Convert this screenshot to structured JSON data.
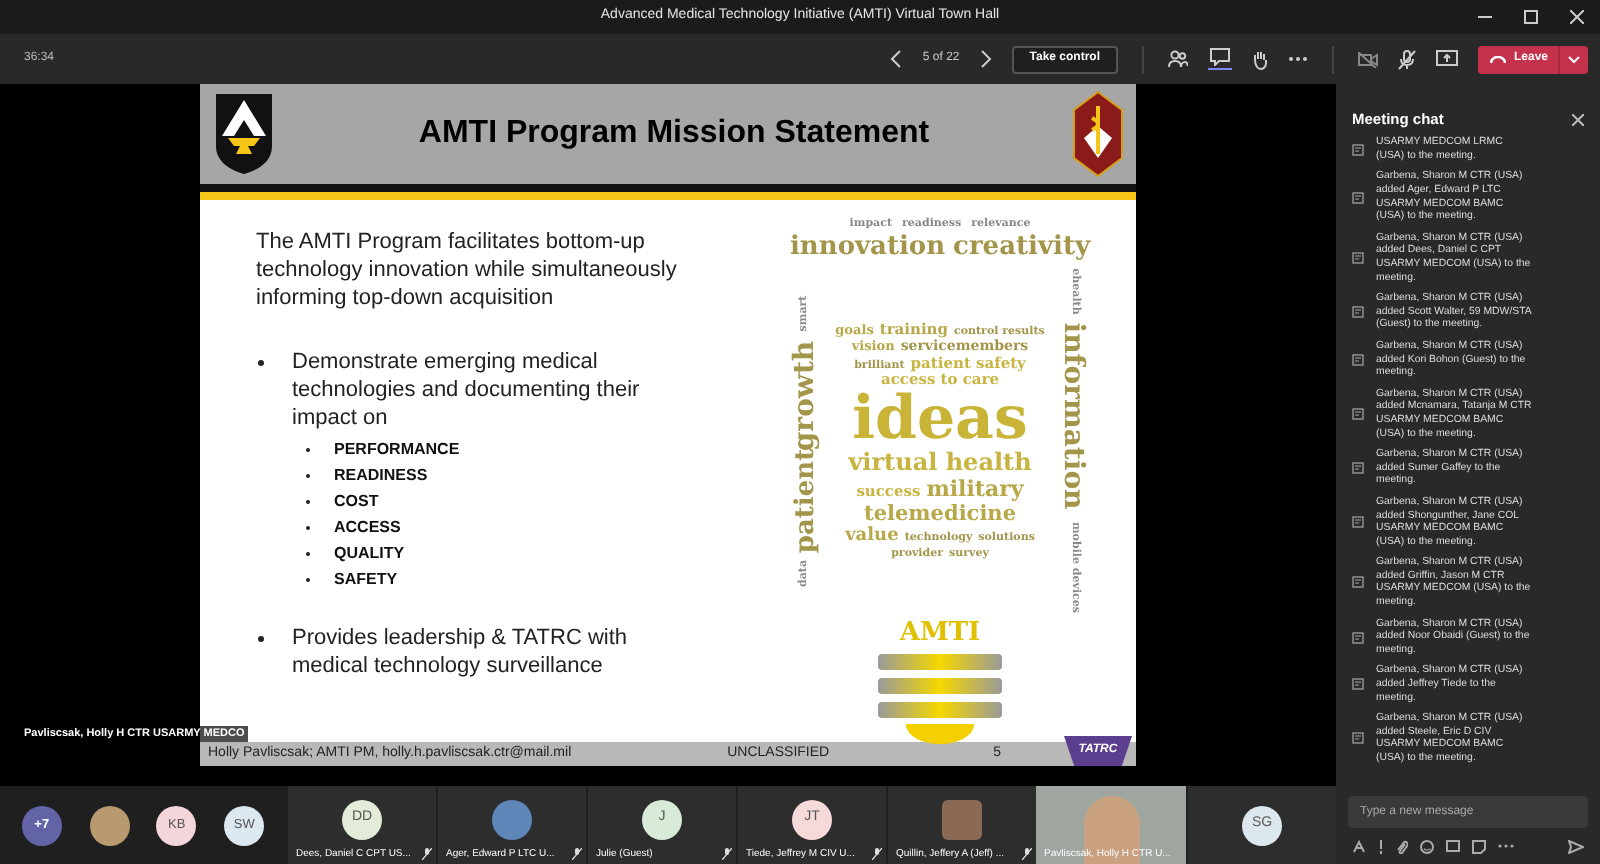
{
  "window": {
    "title": "Advanced Medical Technology Initiative (AMTI) Virtual Town Hall"
  },
  "toolbar": {
    "timer": "36:34",
    "page": "5 of 22",
    "take_control": "Take control",
    "leave": "Leave",
    "chat_selected": true
  },
  "slide": {
    "title": "AMTI Program Mission Statement",
    "intro": "The AMTI Program facilitates bottom-up technology innovation while simultaneously informing top-down acquisition",
    "bullets": [
      {
        "text": "Demonstrate emerging medical technologies and documenting their impact on",
        "children": [
          "PERFORMANCE",
          "READINESS",
          "COST",
          "ACCESS",
          "QUALITY",
          "SAFETY"
        ]
      },
      {
        "text": "Provides leadership & TATRC with medical technology surveillance"
      }
    ],
    "word_cloud": {
      "top": [
        "impact",
        "readiness",
        "relevance"
      ],
      "arch": [
        "innovation",
        "creativity"
      ],
      "left": [
        "smart",
        "growth",
        "patient",
        "data"
      ],
      "center": [
        [
          "goals",
          "training",
          "control results"
        ],
        [
          "vision",
          "servicemembers"
        ],
        [
          "brilliant",
          "patient safety"
        ],
        [
          "access to care"
        ],
        [
          "ideas"
        ],
        [
          "virtual health"
        ],
        [
          "success",
          "military"
        ],
        [
          "telemedicine"
        ],
        [
          "value",
          "technology",
          "solutions"
        ],
        [
          "provider",
          "survey"
        ]
      ],
      "right": [
        "ehealth",
        "information",
        "mobile devices"
      ],
      "label": "AMTI"
    },
    "footer": "Holly Pavliscsak; AMTI PM, holly.h.pavliscsak.ctr@mail.mil",
    "classification": "UNCLASSIFIED",
    "page_number": "5",
    "logo": "TATRC"
  },
  "presenter_label": "Pavliscsak, Holly H CTR USARMY MEDCO",
  "roster": [
    {
      "kind": "overflow",
      "label": "+7",
      "color": "#6264a7"
    },
    {
      "kind": "photo",
      "color": "#b89a70"
    },
    {
      "kind": "initials",
      "label": "KB",
      "color": "#f3d5da"
    },
    {
      "kind": "initials",
      "label": "SW",
      "color": "#dce8ef"
    }
  ],
  "tiles": [
    {
      "kind": "initials",
      "initials": "DD",
      "name": "Dees, Daniel C CPT US...",
      "muted": true,
      "color": "#e3ecd8"
    },
    {
      "kind": "picture",
      "name": "Ager, Edward P LTC U...",
      "muted": true,
      "color": "#5f86b8"
    },
    {
      "kind": "initials",
      "initials": "J",
      "name": "Julie (Guest)",
      "muted": true,
      "color": "#d8ead8"
    },
    {
      "kind": "initials",
      "initials": "JT",
      "name": "Tiede, Jeffrey M CIV U...",
      "muted": true,
      "color": "#f6dada"
    },
    {
      "kind": "photo",
      "name": "Quillin, Jeffery A (Jeff) ...",
      "muted": true,
      "color": "#8a6a55"
    },
    {
      "kind": "video",
      "name": "Pavliscsak, Holly H CTR U...",
      "muted": false,
      "color": "#c9a080"
    },
    {
      "kind": "initials",
      "initials": "SG",
      "color": "#dde7ee"
    }
  ],
  "chat": {
    "title": "Meeting chat",
    "placeholder": "Type a new message",
    "messages": [
      {
        "text": "USARMY MEDCOM LRMC (USA) to the meeting."
      },
      {
        "text": "Garbena, Sharon M CTR (USA) added Ager, Edward P LTC USARMY MEDCOM BAMC (USA) to the meeting."
      },
      {
        "text": "Garbena, Sharon M CTR (USA) added Dees, Daniel C CPT USARMY MEDCOM (USA) to the meeting."
      },
      {
        "text": "Garbena, Sharon M CTR (USA) added Scott Walter, 59 MDW/STA (Guest) to the meeting."
      },
      {
        "text": "Garbena, Sharon M CTR (USA) added Kori Bohon (Guest) to the meeting."
      },
      {
        "text": "Garbena, Sharon M CTR (USA) added Mcnamara, Tatanja M CTR USARMY MEDCOM BAMC (USA) to the meeting."
      },
      {
        "text": "Garbena, Sharon M CTR (USA) added Sumer Gaffey to the meeting."
      },
      {
        "text": "Garbena, Sharon M CTR (USA) added Shongunther, Jane COL USARMY MEDCOM BAMC (USA) to the meeting."
      },
      {
        "text": "Garbena, Sharon M CTR (USA) added Griffin, Jason M CTR USARMY MEDCOM (USA) to the meeting."
      },
      {
        "text": "Garbena, Sharon M CTR (USA) added Noor Obaidi (Guest) to the meeting."
      },
      {
        "text": "Garbena, Sharon M CTR (USA) added Jeffrey Tiede to the meeting."
      },
      {
        "text": "Garbena, Sharon M CTR (USA) added Steele, Eric D CIV USARMY MEDCOM BAMC (USA) to the meeting."
      }
    ]
  }
}
